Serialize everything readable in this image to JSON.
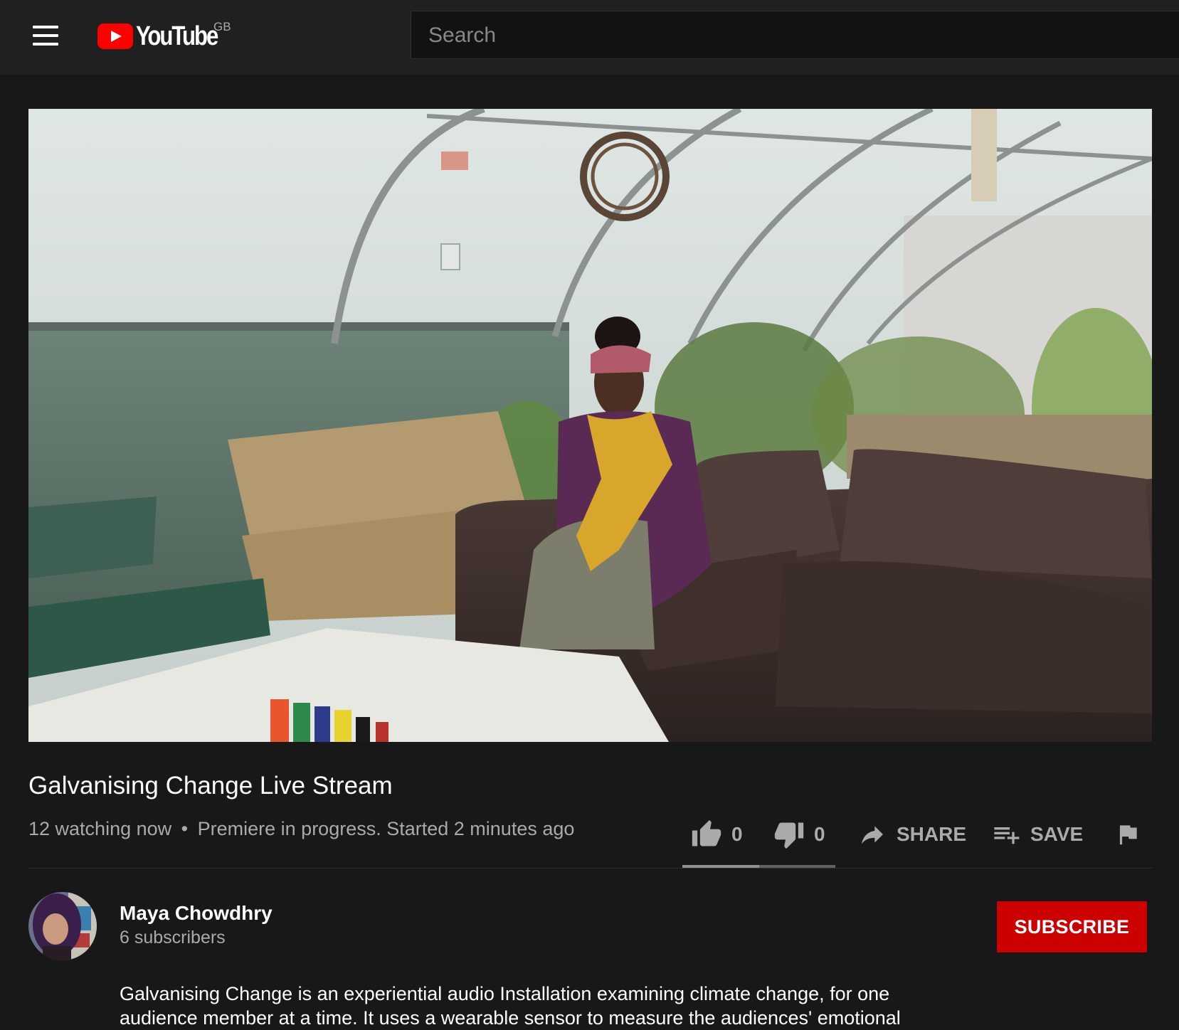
{
  "header": {
    "logo_text": "YouTube",
    "country_code": "GB",
    "search_placeholder": "Search"
  },
  "video": {
    "title": "Galvanising Change Live Stream",
    "watching": "12 watching now",
    "separator": "•",
    "status": "Premiere in progress. Started 2 minutes ago"
  },
  "actions": {
    "like_count": "0",
    "dislike_count": "0",
    "share_label": "SHARE",
    "save_label": "SAVE"
  },
  "channel": {
    "name": "Maya Chowdhry",
    "subscribers": "6 subscribers",
    "subscribe_label": "SUBSCRIBE"
  },
  "description": {
    "line1": "Galvanising Change is an experiential audio Installation examining climate change, for one",
    "line2": "audience member at a time. It uses a wearable sensor to measure the audiences' emotional"
  },
  "colors": {
    "background": "#181818",
    "header": "#202020",
    "subscribe": "#cc0000",
    "text_secondary": "#aaaaaa"
  },
  "icons": [
    "menu-icon",
    "youtube-logo",
    "thumbs-up-icon",
    "thumbs-down-icon",
    "share-icon",
    "playlist-add-icon",
    "flag-icon"
  ]
}
